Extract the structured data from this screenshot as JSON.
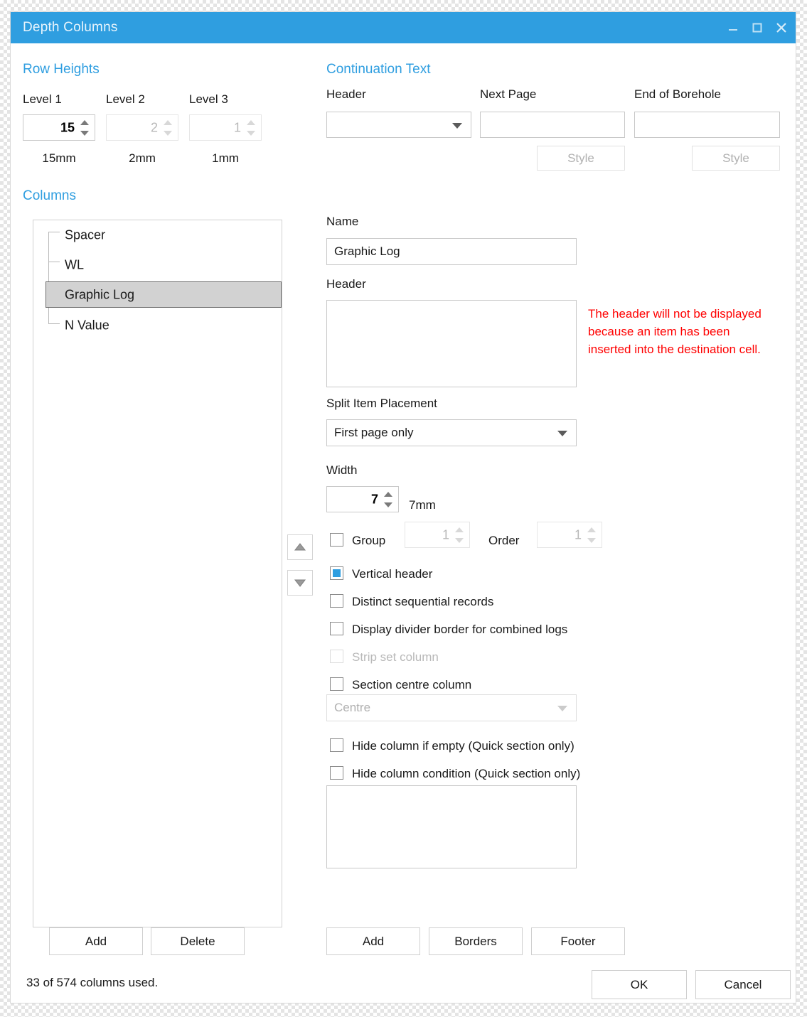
{
  "window": {
    "title": "Depth Columns",
    "minimize_icon": "minimize-icon",
    "maximize_icon": "maximize-icon",
    "close_icon": "close-icon"
  },
  "row_heights": {
    "heading": "Row Heights",
    "levels": [
      {
        "label": "Level 1",
        "value": "15",
        "unit": "15mm",
        "enabled": true
      },
      {
        "label": "Level 2",
        "value": "2",
        "unit": "2mm",
        "enabled": false
      },
      {
        "label": "Level 3",
        "value": "1",
        "unit": "1mm",
        "enabled": false
      }
    ]
  },
  "continuation_text": {
    "heading": "Continuation Text",
    "header_label": "Header",
    "header_value": "",
    "next_page_label": "Next Page",
    "next_page_value": "",
    "end_of_borehole_label": "End of Borehole",
    "end_of_borehole_value": "",
    "next_page_style_button": "Style",
    "end_style_button": "Style"
  },
  "columns": {
    "heading": "Columns",
    "items": [
      {
        "label": "Spacer",
        "selected": false
      },
      {
        "label": "WL",
        "selected": false
      },
      {
        "label": "Graphic Log",
        "selected": true
      },
      {
        "label": "N Value",
        "selected": false
      }
    ],
    "move_up_icon": "arrow-up-icon",
    "move_down_icon": "arrow-down-icon",
    "add_button": "Add",
    "delete_button": "Delete"
  },
  "details": {
    "name_label": "Name",
    "name_value": "Graphic Log",
    "header_label": "Header",
    "header_value": "",
    "header_warning": "The header will not be displayed because an item has been inserted into the destination cell.",
    "split_item_placement_label": "Split Item Placement",
    "split_item_placement_value": "First page only",
    "width_label": "Width",
    "width_value": "7",
    "width_unit": "7mm",
    "group_label": "Group",
    "group_checked": false,
    "group_value": "1",
    "group_enabled": false,
    "order_label": "Order",
    "order_value": "1",
    "order_enabled": false,
    "checkboxes": [
      {
        "label": "Vertical header",
        "checked": true,
        "enabled": true
      },
      {
        "label": "Distinct sequential records",
        "checked": false,
        "enabled": true
      },
      {
        "label": "Display divider border for combined logs",
        "checked": false,
        "enabled": true
      },
      {
        "label": "Strip set column",
        "checked": false,
        "enabled": false
      },
      {
        "label": "Section centre column",
        "checked": false,
        "enabled": true
      }
    ],
    "centre_dropdown_value": "Centre",
    "centre_dropdown_enabled": false,
    "hide_if_empty": {
      "label": "Hide column if empty (Quick section only)",
      "checked": false
    },
    "hide_condition": {
      "label": "Hide column condition (Quick section only)",
      "checked": false
    },
    "condition_textarea_value": "",
    "add_button": "Add",
    "borders_button": "Borders",
    "footer_button": "Footer"
  },
  "footer": {
    "status": "33 of 574 columns used.",
    "ok_button": "OK",
    "cancel_button": "Cancel"
  },
  "colors": {
    "accent": "#2f9ee0",
    "warning": "#ff0000",
    "selection": "#d2d2d2"
  }
}
